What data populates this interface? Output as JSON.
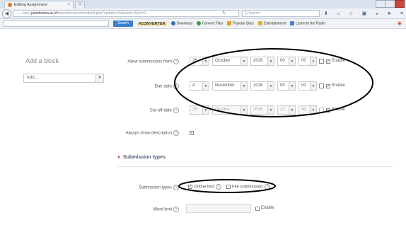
{
  "browser": {
    "tab_title": "Editing Assignment",
    "tab_close": "×",
    "new_tab": "+",
    "url_prefix": "——www.",
    "url_domain": "juriedarena.ac.id",
    "url_rest": "/moodle/course/modedit.php?update=44&return=1&sr=0",
    "search_placeholder": "Q Search",
    "back": "◀"
  },
  "toolbar": {
    "search_button": "Search",
    "brand": "#CONVERTER",
    "links": [
      {
        "label": "Download",
        "color": "#2f6fb3"
      },
      {
        "label": "Convert Files",
        "color": "#3a9a4a"
      },
      {
        "label": "Popular Sites",
        "color": "#e0a020"
      },
      {
        "label": "Entertainment",
        "color": "#d9b23a"
      },
      {
        "label": "Listen to the Radio",
        "color": "#4a7fd0"
      }
    ]
  },
  "page": {
    "add_block": {
      "title": "Add a block",
      "select_value": "Add..."
    },
    "allow_submissions": {
      "label": "Allow submissions from",
      "day": "26",
      "month": "October",
      "year": "2016",
      "hour": "00",
      "minute": "00",
      "enable_label": "Enable",
      "enabled": true
    },
    "due_date": {
      "label": "Due date",
      "day": "4",
      "month": "November",
      "year": "2016",
      "hour": "00",
      "minute": "00",
      "enable_label": "Enable",
      "enabled": true
    },
    "cutoff_date": {
      "label": "Cut-off date",
      "day": "26",
      "month": "October",
      "year": "2016",
      "hour": "12",
      "minute": "40",
      "enable_label": "Enable",
      "enabled": false
    },
    "always_show_description": {
      "label": "Always show description",
      "checked": true
    },
    "submission_types_section": {
      "title": "Submission types"
    },
    "submission_types": {
      "label": "Submission types",
      "online_text": "Online text",
      "online_text_checked": true,
      "file_submissions": "File submissions",
      "file_submissions_checked": false
    },
    "word_limit": {
      "label": "Word limit",
      "enable_label": "Enable",
      "enabled": false
    }
  },
  "help_glyph": "?",
  "check_glyph": "✓",
  "colors": {
    "annotation": "#000000",
    "section_toggle": "#cc3333",
    "search_button": "#3d7fd1"
  }
}
